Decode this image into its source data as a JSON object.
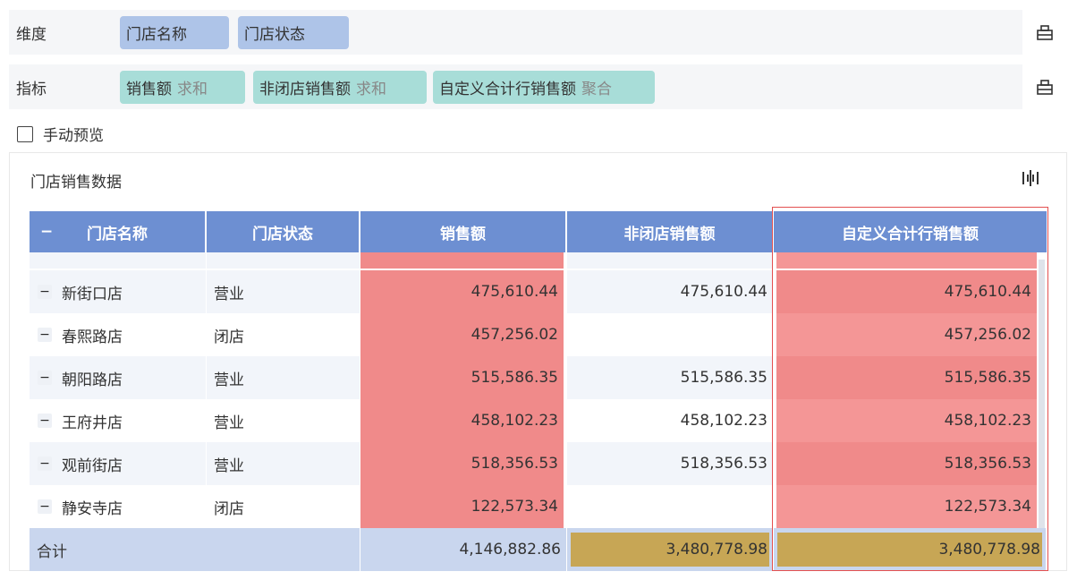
{
  "dimension_bar": {
    "label": "维度",
    "chips": [
      "门店名称",
      "门店状态"
    ]
  },
  "measure_bar": {
    "label": "指标",
    "chips": [
      {
        "name": "销售额",
        "agg": "求和"
      },
      {
        "name": "非闭店销售额",
        "agg": "求和"
      },
      {
        "name": "自定义合计行销售额",
        "agg": "聚合"
      }
    ]
  },
  "manual_preview": {
    "label": "手动预览",
    "checked": false
  },
  "panel": {
    "title": "门店销售数据"
  },
  "table": {
    "headers": [
      "门店名称",
      "门店状态",
      "销售额",
      "非闭店销售额",
      "自定义合计行销售额"
    ],
    "collapse_symbol": "−",
    "rows": [
      {
        "name": "新街口店",
        "status": "营业",
        "sales": "475,610.44",
        "open_sales": "475,610.44",
        "custom": "475,610.44"
      },
      {
        "name": "春熙路店",
        "status": "闭店",
        "sales": "457,256.02",
        "open_sales": "",
        "custom": "457,256.02"
      },
      {
        "name": "朝阳路店",
        "status": "营业",
        "sales": "515,586.35",
        "open_sales": "515,586.35",
        "custom": "515,586.35"
      },
      {
        "name": "王府井店",
        "status": "营业",
        "sales": "458,102.23",
        "open_sales": "458,102.23",
        "custom": "458,102.23"
      },
      {
        "name": "观前街店",
        "status": "营业",
        "sales": "518,356.53",
        "open_sales": "518,356.53",
        "custom": "518,356.53"
      },
      {
        "name": "静安寺店",
        "status": "闭店",
        "sales": "122,573.34",
        "open_sales": "",
        "custom": "122,573.34"
      }
    ],
    "total": {
      "label": "合计",
      "sales": "4,146,882.86",
      "open_sales": "3,480,778.98",
      "custom": "3,480,778.98"
    }
  },
  "colors": {
    "header": "#6d8fd2",
    "highlight_red": "#f08a8a",
    "highlight_gold": "#c7a655",
    "total_row": "#c9d6ee",
    "selection_frame": "#e35050"
  }
}
